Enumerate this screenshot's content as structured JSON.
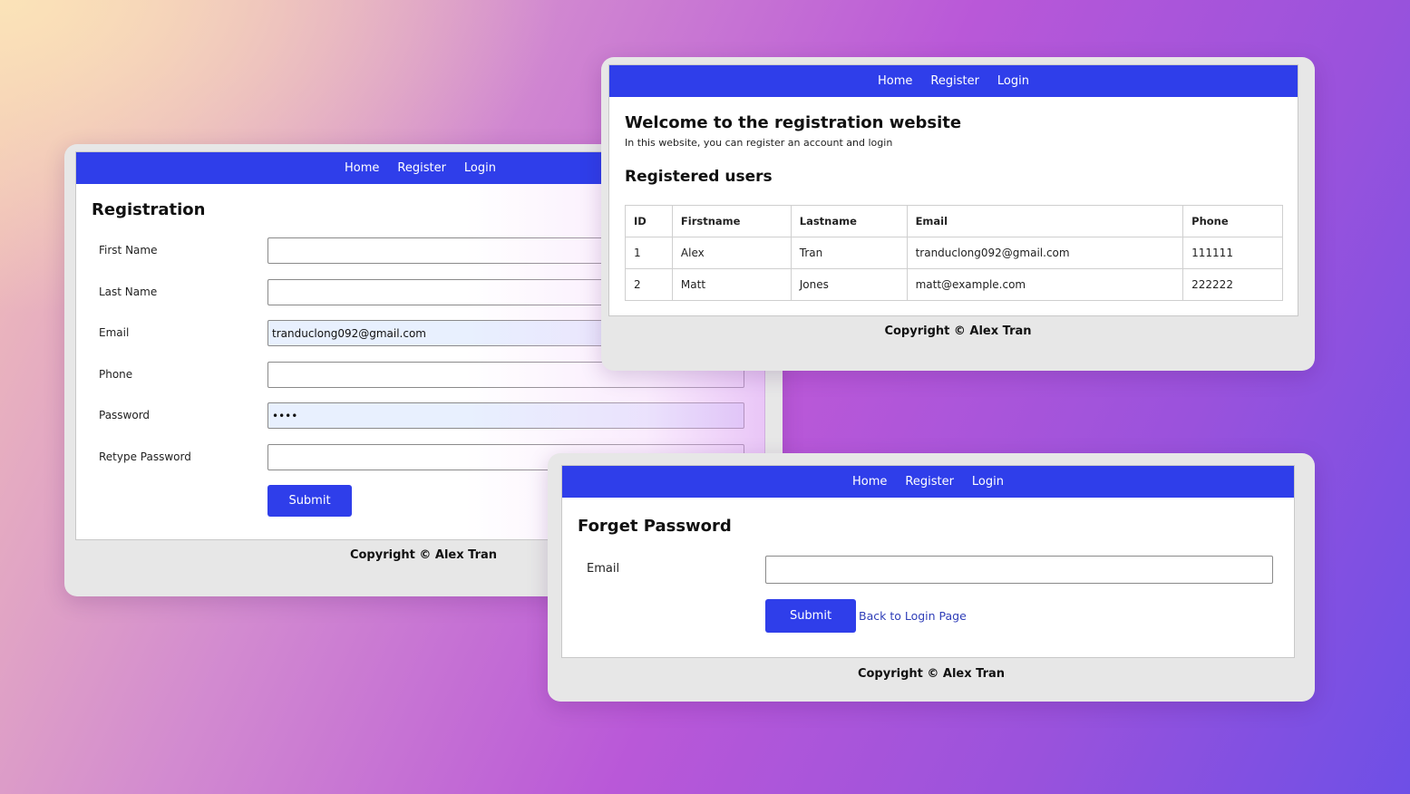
{
  "nav": {
    "home": "Home",
    "register": "Register",
    "login": "Login"
  },
  "footer": "Copyright © Alex Tran",
  "registration": {
    "title": "Registration",
    "fields": [
      {
        "label": "First Name",
        "value": ""
      },
      {
        "label": "Last Name",
        "value": ""
      },
      {
        "label": "Email",
        "value": "tranduclong092@gmail.com"
      },
      {
        "label": "Phone",
        "value": ""
      },
      {
        "label": "Password",
        "value": "••••"
      },
      {
        "label": "Retype Password",
        "value": ""
      }
    ],
    "submit": "Submit"
  },
  "home": {
    "title": "Welcome to the registration website",
    "subtitle": "In this website, you can register an account and login",
    "users_heading": "Registered users",
    "columns": [
      "ID",
      "Firstname",
      "Lastname",
      "Email",
      "Phone"
    ],
    "rows": [
      [
        "1",
        "Alex",
        "Tran",
        "tranduclong092@gmail.com",
        "111111"
      ],
      [
        "2",
        "Matt",
        "Jones",
        "matt@example.com",
        "222222"
      ]
    ]
  },
  "forget": {
    "title": "Forget Password",
    "email_label": "Email",
    "email_value": "",
    "submit": "Submit",
    "back_link": "Back to Login Page"
  },
  "colors": {
    "nav": "#2f3eea",
    "button": "#2f3eea",
    "autofill": "#e8f0fe",
    "link": "#2f3eb8"
  }
}
